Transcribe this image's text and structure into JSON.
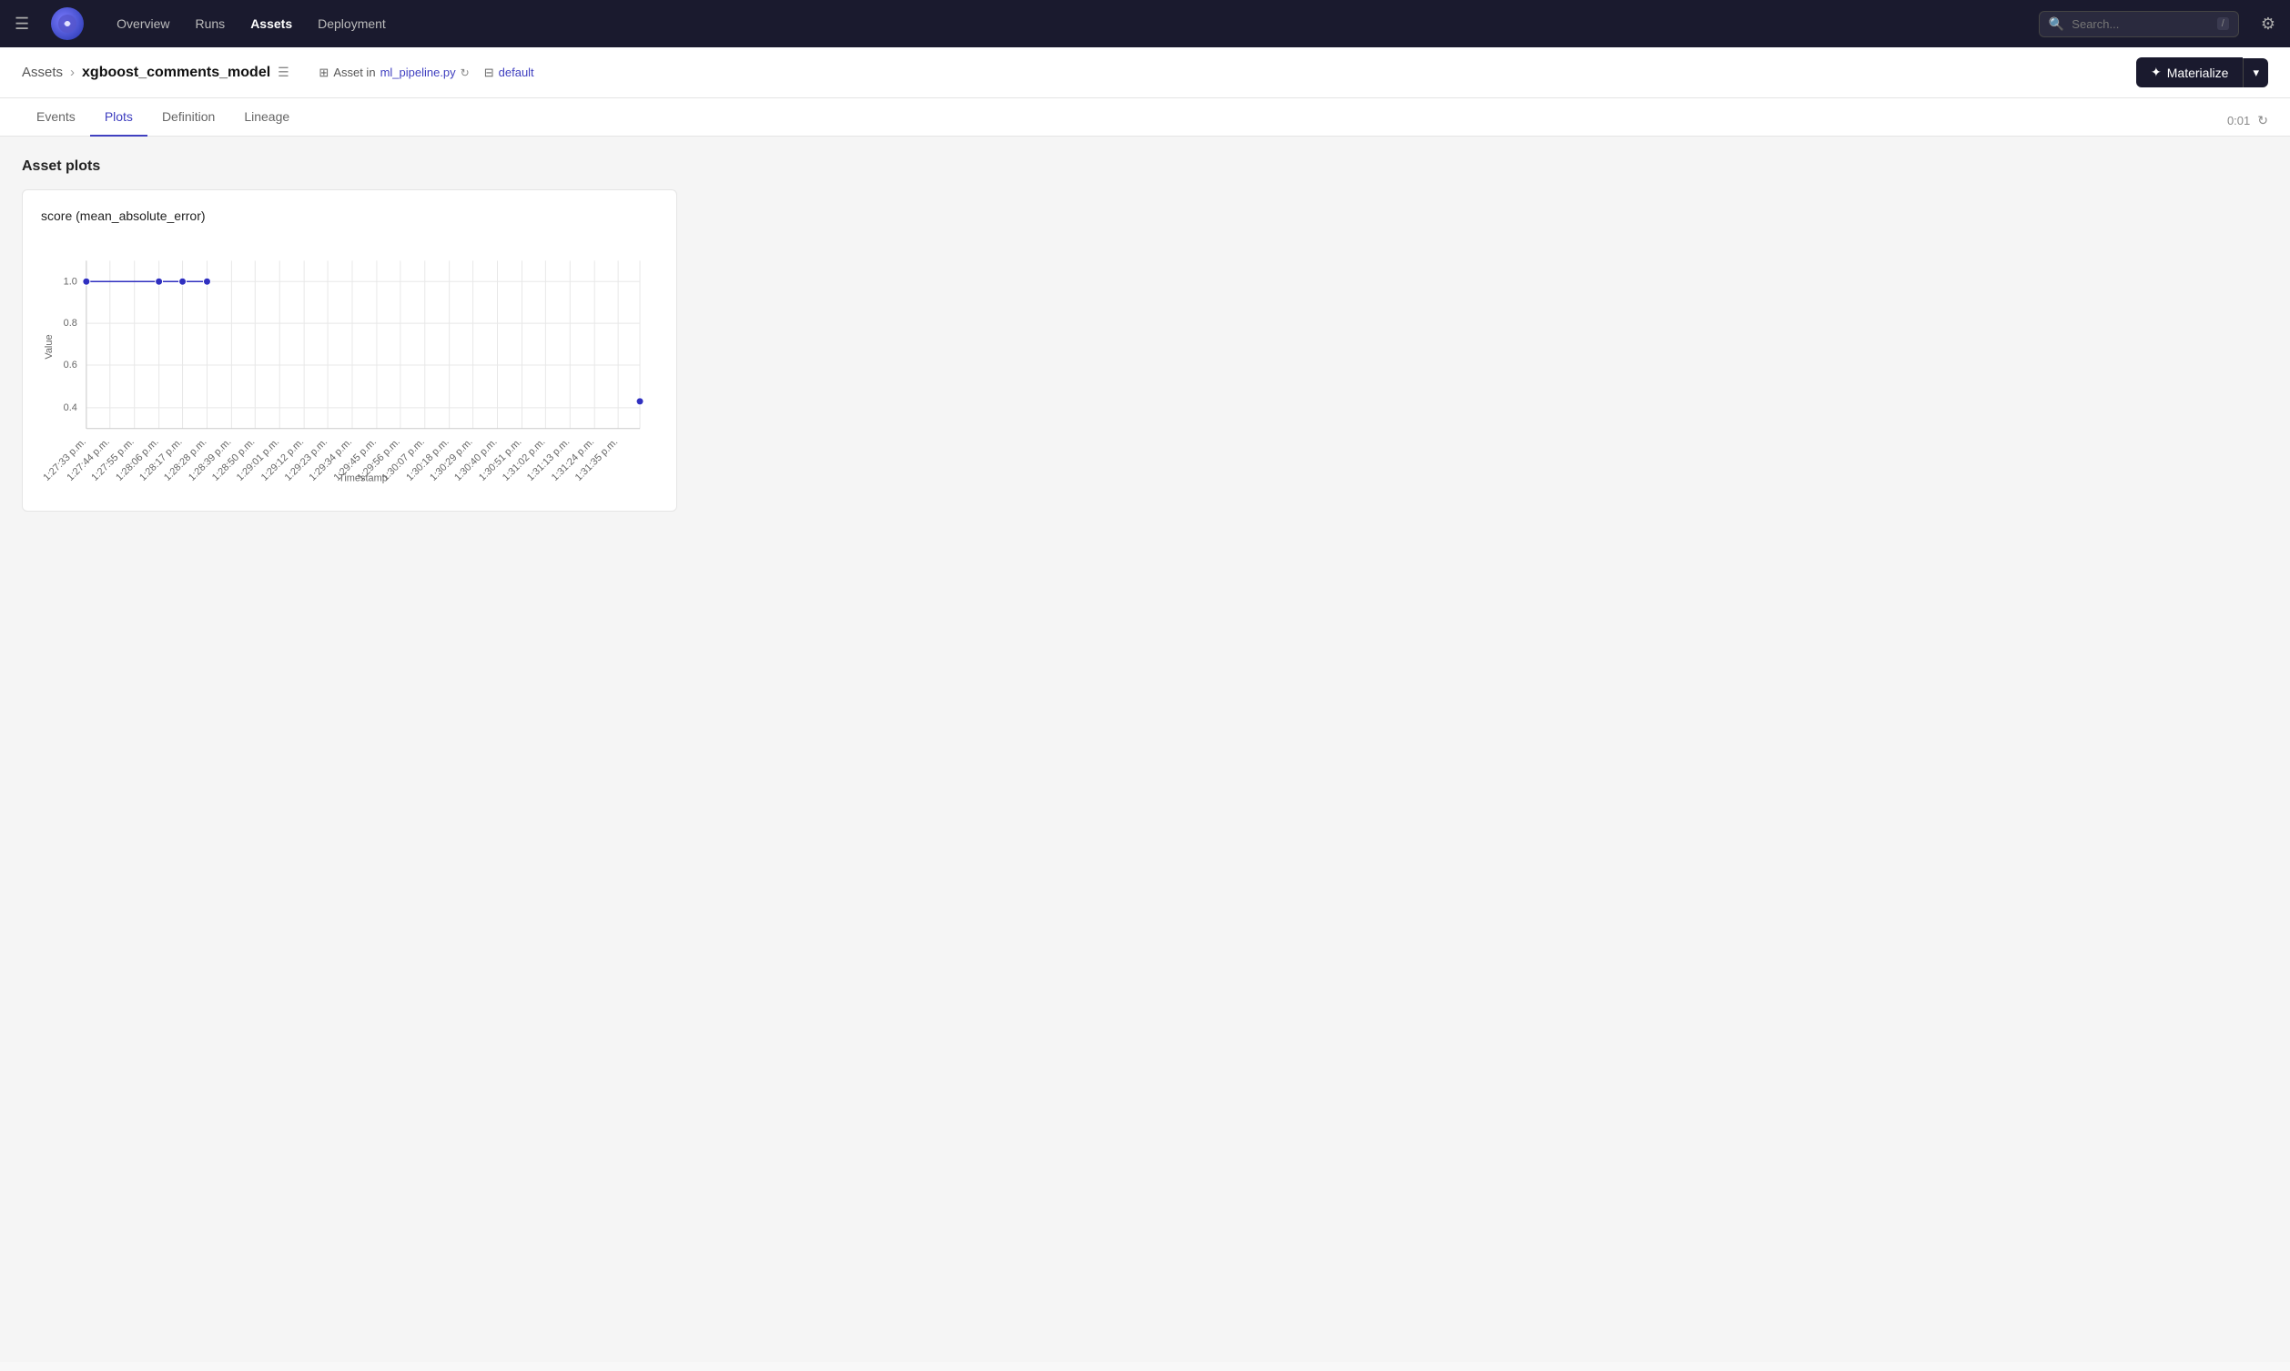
{
  "topnav": {
    "logo_emoji": "🐙",
    "nav_links": [
      {
        "label": "Overview",
        "active": false
      },
      {
        "label": "Runs",
        "active": false
      },
      {
        "label": "Assets",
        "active": true
      },
      {
        "label": "Deployment",
        "active": false
      }
    ],
    "search_placeholder": "Search...",
    "search_kbd": "/"
  },
  "asset_header": {
    "breadcrumb_root": "Assets",
    "asset_name": "xgboost_comments_model",
    "asset_in_label": "Asset in",
    "file_name": "ml_pipeline.py",
    "repo_label": "default"
  },
  "materialize": {
    "btn_label": "Materialize",
    "sparkle": "✦"
  },
  "tabs": [
    {
      "label": "Events",
      "active": false
    },
    {
      "label": "Plots",
      "active": true
    },
    {
      "label": "Definition",
      "active": false
    },
    {
      "label": "Lineage",
      "active": false
    }
  ],
  "timer": "0:01",
  "section": {
    "title": "Asset plots"
  },
  "chart": {
    "title": "score (mean_absolute_error)",
    "x_label": "Timestamp",
    "y_label": "Value",
    "y_ticks": [
      "0.4",
      "0.6",
      "0.8",
      "1.0"
    ],
    "x_ticks": [
      "1:27:33 p.m.",
      "1:27:44 p.m.",
      "1:27:55 p.m.",
      "1:28:06 p.m.",
      "1:28:17 p.m.",
      "1:28:28 p.m.",
      "1:28:39 p.m.",
      "1:28:50 p.m.",
      "1:29:01 p.m.",
      "1:29:12 p.m.",
      "1:29:23 p.m.",
      "1:29:34 p.m.",
      "1:29:45 p.m.",
      "1:29:56 p.m.",
      "1:30:07 p.m.",
      "1:30:18 p.m.",
      "1:30:29 p.m.",
      "1:30:40 p.m.",
      "1:30:51 p.m.",
      "1:31:02 p.m.",
      "1:31:13 p.m.",
      "1:31:24 p.m.",
      "1:31:35 p.m."
    ],
    "data_points": [
      {
        "x_index": 0,
        "value": 1.0
      },
      {
        "x_index": 3,
        "value": 1.0
      },
      {
        "x_index": 4,
        "value": 1.0
      },
      {
        "x_index": 5,
        "value": 1.0
      },
      {
        "x_index": 22,
        "value": 0.43
      }
    ]
  }
}
